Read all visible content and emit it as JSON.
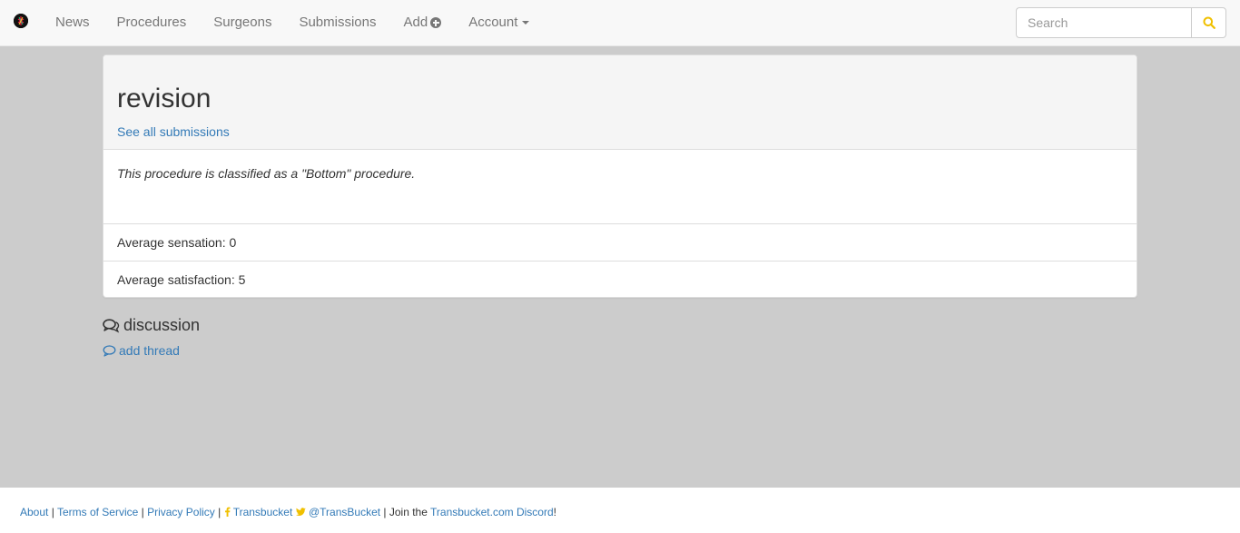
{
  "nav": {
    "items": [
      "News",
      "Procedures",
      "Surgeons",
      "Submissions"
    ],
    "add_label": "Add",
    "account_label": "Account"
  },
  "search": {
    "placeholder": "Search"
  },
  "panel": {
    "title": "revision",
    "see_all": "See all submissions",
    "classification": "This procedure is classified as a \"Bottom\" procedure.",
    "rows": [
      "Average sensation: 0",
      "Average satisfaction: 5"
    ]
  },
  "discussion": {
    "title": "discussion",
    "add_thread": "add thread"
  },
  "footer": {
    "about": "About",
    "sep1": " | ",
    "terms": "Terms of Service",
    "sep2": " | ",
    "privacy": "Privacy Policy",
    "sep3": " | ",
    "facebook": "Transbucket",
    "twitter": "@TransBucket",
    "join_prefix": " | Join the ",
    "discord": "Transbucket.com Discord",
    "join_suffix": "!"
  },
  "colors": {
    "accent": "#f0c000",
    "link": "#337ab7",
    "page_bg": "#cccccc"
  }
}
